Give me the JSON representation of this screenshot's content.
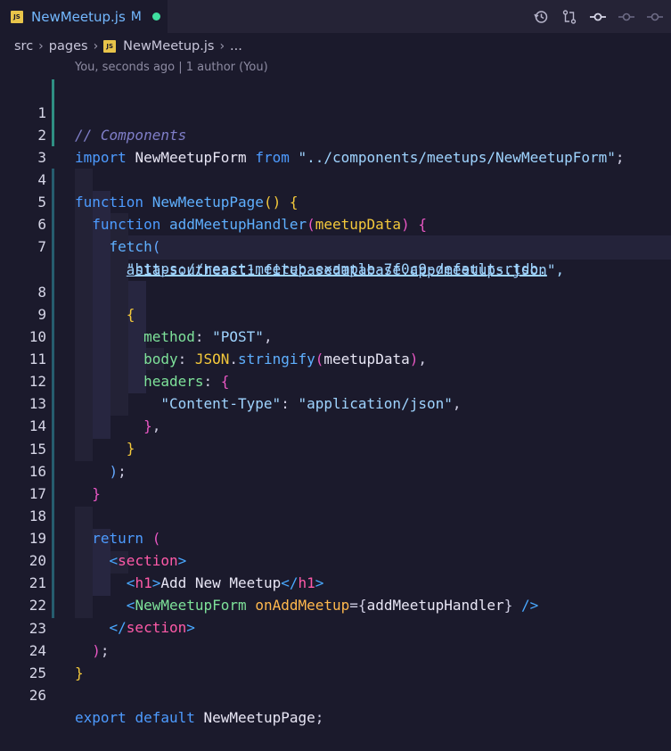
{
  "tab": {
    "filename": "NewMeetup.js",
    "status": "M",
    "file_badge": "JS",
    "status_color": "#3fe0a0"
  },
  "toolbar": {
    "icons": [
      "history-icon",
      "compare-changes-icon",
      "commit-icon",
      "previous-change-icon",
      "next-change-icon"
    ]
  },
  "breadcrumb": {
    "items": [
      "src",
      "pages",
      "NewMeetup.js",
      "..."
    ]
  },
  "blame": "You, seconds ago | 1 author (You)",
  "code": {
    "line_numbers": [
      "1",
      "2",
      "3",
      "4",
      "5",
      "6",
      "7",
      "8",
      "9",
      "10",
      "11",
      "12",
      "13",
      "14",
      "15",
      "16",
      "17",
      "18",
      "19",
      "20",
      "21",
      "22",
      "23",
      "24",
      "25",
      "26"
    ],
    "l1": "// Components",
    "l2_kw": "import",
    "l2_id": "NewMeetupForm",
    "l2_from": "from",
    "l2_str": "\"../components/meetups/NewMeetupForm\"",
    "l2_semi": ";",
    "l4_kw": "function",
    "l4_fn": "NewMeetupPage",
    "l4_paren": "()",
    "l4_brace": "{",
    "l5_kw": "function",
    "l5_fn": "addMeetupHandler",
    "l5_open": "(",
    "l5_param": "meetupData",
    "l5_close": ")",
    "l5_brace": "{",
    "l6_fn": "fetch",
    "l6_open": "(",
    "l7_quote": "\"",
    "l7_url": "https://react-meetup-example-7f0c9-default-rtdb.",
    "l7b_url": "asia-southeast1.firebasedatabase.app/meetups.json",
    "l7b_end": "\",",
    "l8_brace": "{",
    "l9_prop": "method",
    "l9_colon": ":",
    "l9_str": "\"POST\"",
    "l9_comma": ",",
    "l10_prop": "body",
    "l10_colon": ":",
    "l10_json": "JSON",
    "l10_dot": ".",
    "l10_fn": "stringify",
    "l10_open": "(",
    "l10_arg": "meetupData",
    "l10_close": ")",
    "l10_comma": ",",
    "l11_prop": "headers",
    "l11_colon": ":",
    "l11_brace": "{",
    "l12_key": "\"Content-Type\"",
    "l12_colon": ":",
    "l12_val": "\"application/json\"",
    "l12_comma": ",",
    "l13_brace": "}",
    "l13_comma": ",",
    "l14_brace": "}",
    "l15_paren": ")",
    "l15_semi": ";",
    "l16_brace": "}",
    "l18_kw": "return",
    "l18_paren": "(",
    "l19_lt": "<",
    "l19_tag": "section",
    "l19_gt": ">",
    "l20_lt": "<",
    "l20_tag": "h1",
    "l20_gt": ">",
    "l20_text": "Add New Meetup",
    "l20_lt2": "</",
    "l20_tag2": "h1",
    "l20_gt2": ">",
    "l21_lt": "<",
    "l21_comp": "NewMeetupForm",
    "l21_attr": "onAddMeetup",
    "l21_eq": "=",
    "l21_open": "{",
    "l21_val": "addMeetupHandler",
    "l21_close": "}",
    "l21_end": "/>",
    "l22_lt": "</",
    "l22_tag": "section",
    "l22_gt": ">",
    "l23_paren": ")",
    "l23_semi": ";",
    "l24_brace": "}",
    "l26_kw1": "export",
    "l26_kw2": "default",
    "l26_id": "NewMeetupPage",
    "l26_semi": ";"
  },
  "colors": {
    "background": "#1b1a2c",
    "tabbar": "#252336",
    "accent": "#73b8ff",
    "git_bar": "#2f8f83"
  }
}
